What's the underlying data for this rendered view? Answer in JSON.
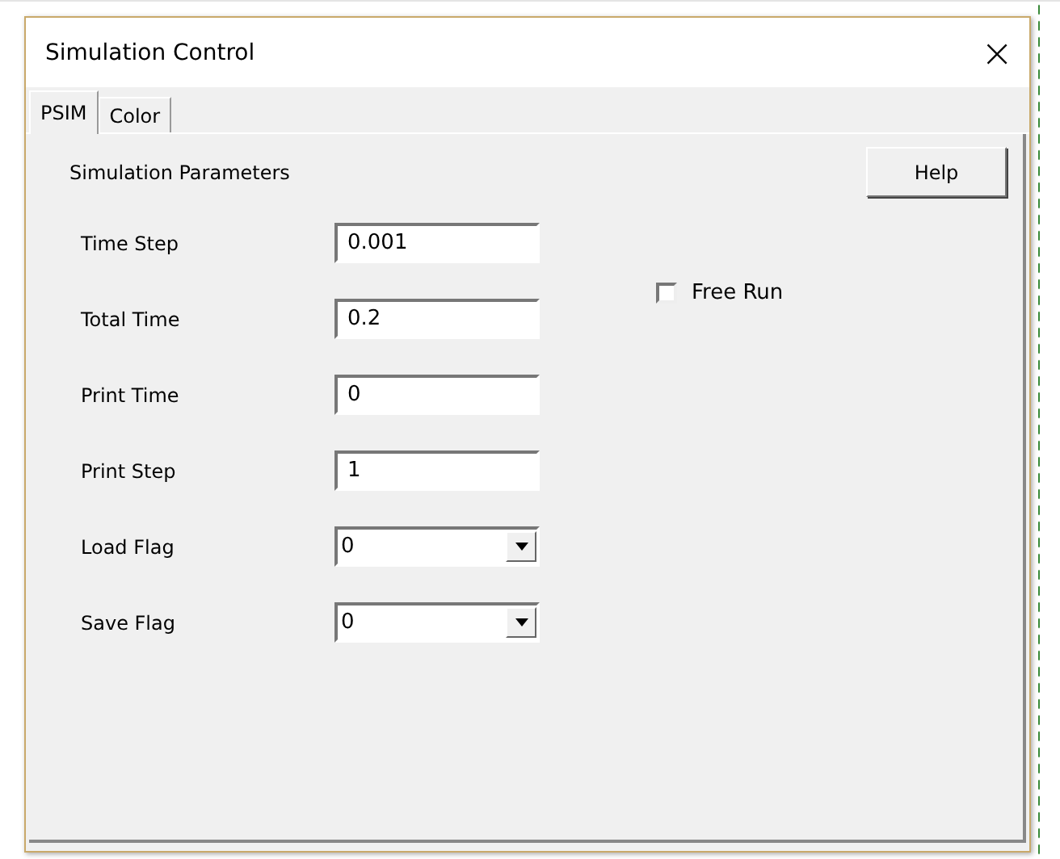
{
  "window": {
    "title": "Simulation Control",
    "close": "×"
  },
  "tabs": [
    {
      "label": "PSIM",
      "selected": true
    },
    {
      "label": "Color",
      "selected": false
    }
  ],
  "section_title": "Simulation Parameters",
  "help_button": "Help",
  "fields": [
    {
      "label": "Time Step",
      "kind": "text",
      "value": "0.001"
    },
    {
      "label": "Total Time",
      "kind": "text",
      "value": "0.2"
    },
    {
      "label": "Print Time",
      "kind": "text",
      "value": "0"
    },
    {
      "label": "Print Step",
      "kind": "text",
      "value": "1"
    },
    {
      "label": "Load Flag",
      "kind": "dropdown",
      "value": "0"
    },
    {
      "label": "Save Flag",
      "kind": "dropdown",
      "value": "0"
    }
  ],
  "free_run": {
    "label": "Free Run",
    "checked": false
  }
}
